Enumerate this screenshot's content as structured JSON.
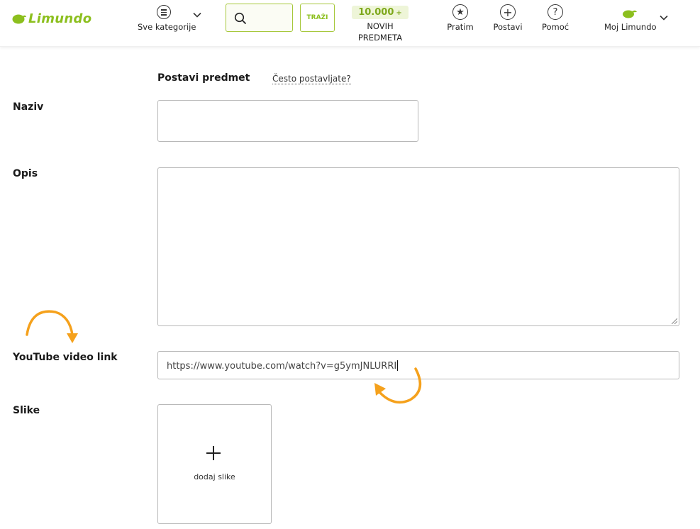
{
  "brand": {
    "name": "Limundo",
    "color": "#8cbf1e"
  },
  "header": {
    "categories_label": "Sve kategorije",
    "search_placeholder": "",
    "search_button": "TRAŽI",
    "new_items": {
      "count": "10.000",
      "plus": "+",
      "label_line1": "NOVIH",
      "label_line2": "PREDMETA"
    },
    "nav": [
      {
        "label": "Pratim",
        "icon": "star-icon"
      },
      {
        "label": "Postavi",
        "icon": "plus-circle-icon"
      },
      {
        "label": "Pomoć",
        "icon": "question-icon"
      }
    ],
    "account_label": "Moj Limundo"
  },
  "form": {
    "title": "Postavi predmet",
    "help_link": "Često postavljate?",
    "fields": {
      "naziv": {
        "label": "Naziv",
        "value": ""
      },
      "opis": {
        "label": "Opis",
        "value": ""
      },
      "youtube": {
        "label": "YouTube video link",
        "value": "https://www.youtube.com/watch?v=g5ymJNLURRI"
      },
      "slike": {
        "label": "Slike",
        "upload_label": "dodaj slike"
      }
    }
  },
  "colors": {
    "accent": "#8cbf1e",
    "annotation_arrow": "#f5a11c",
    "border": "#b8b8b8"
  }
}
